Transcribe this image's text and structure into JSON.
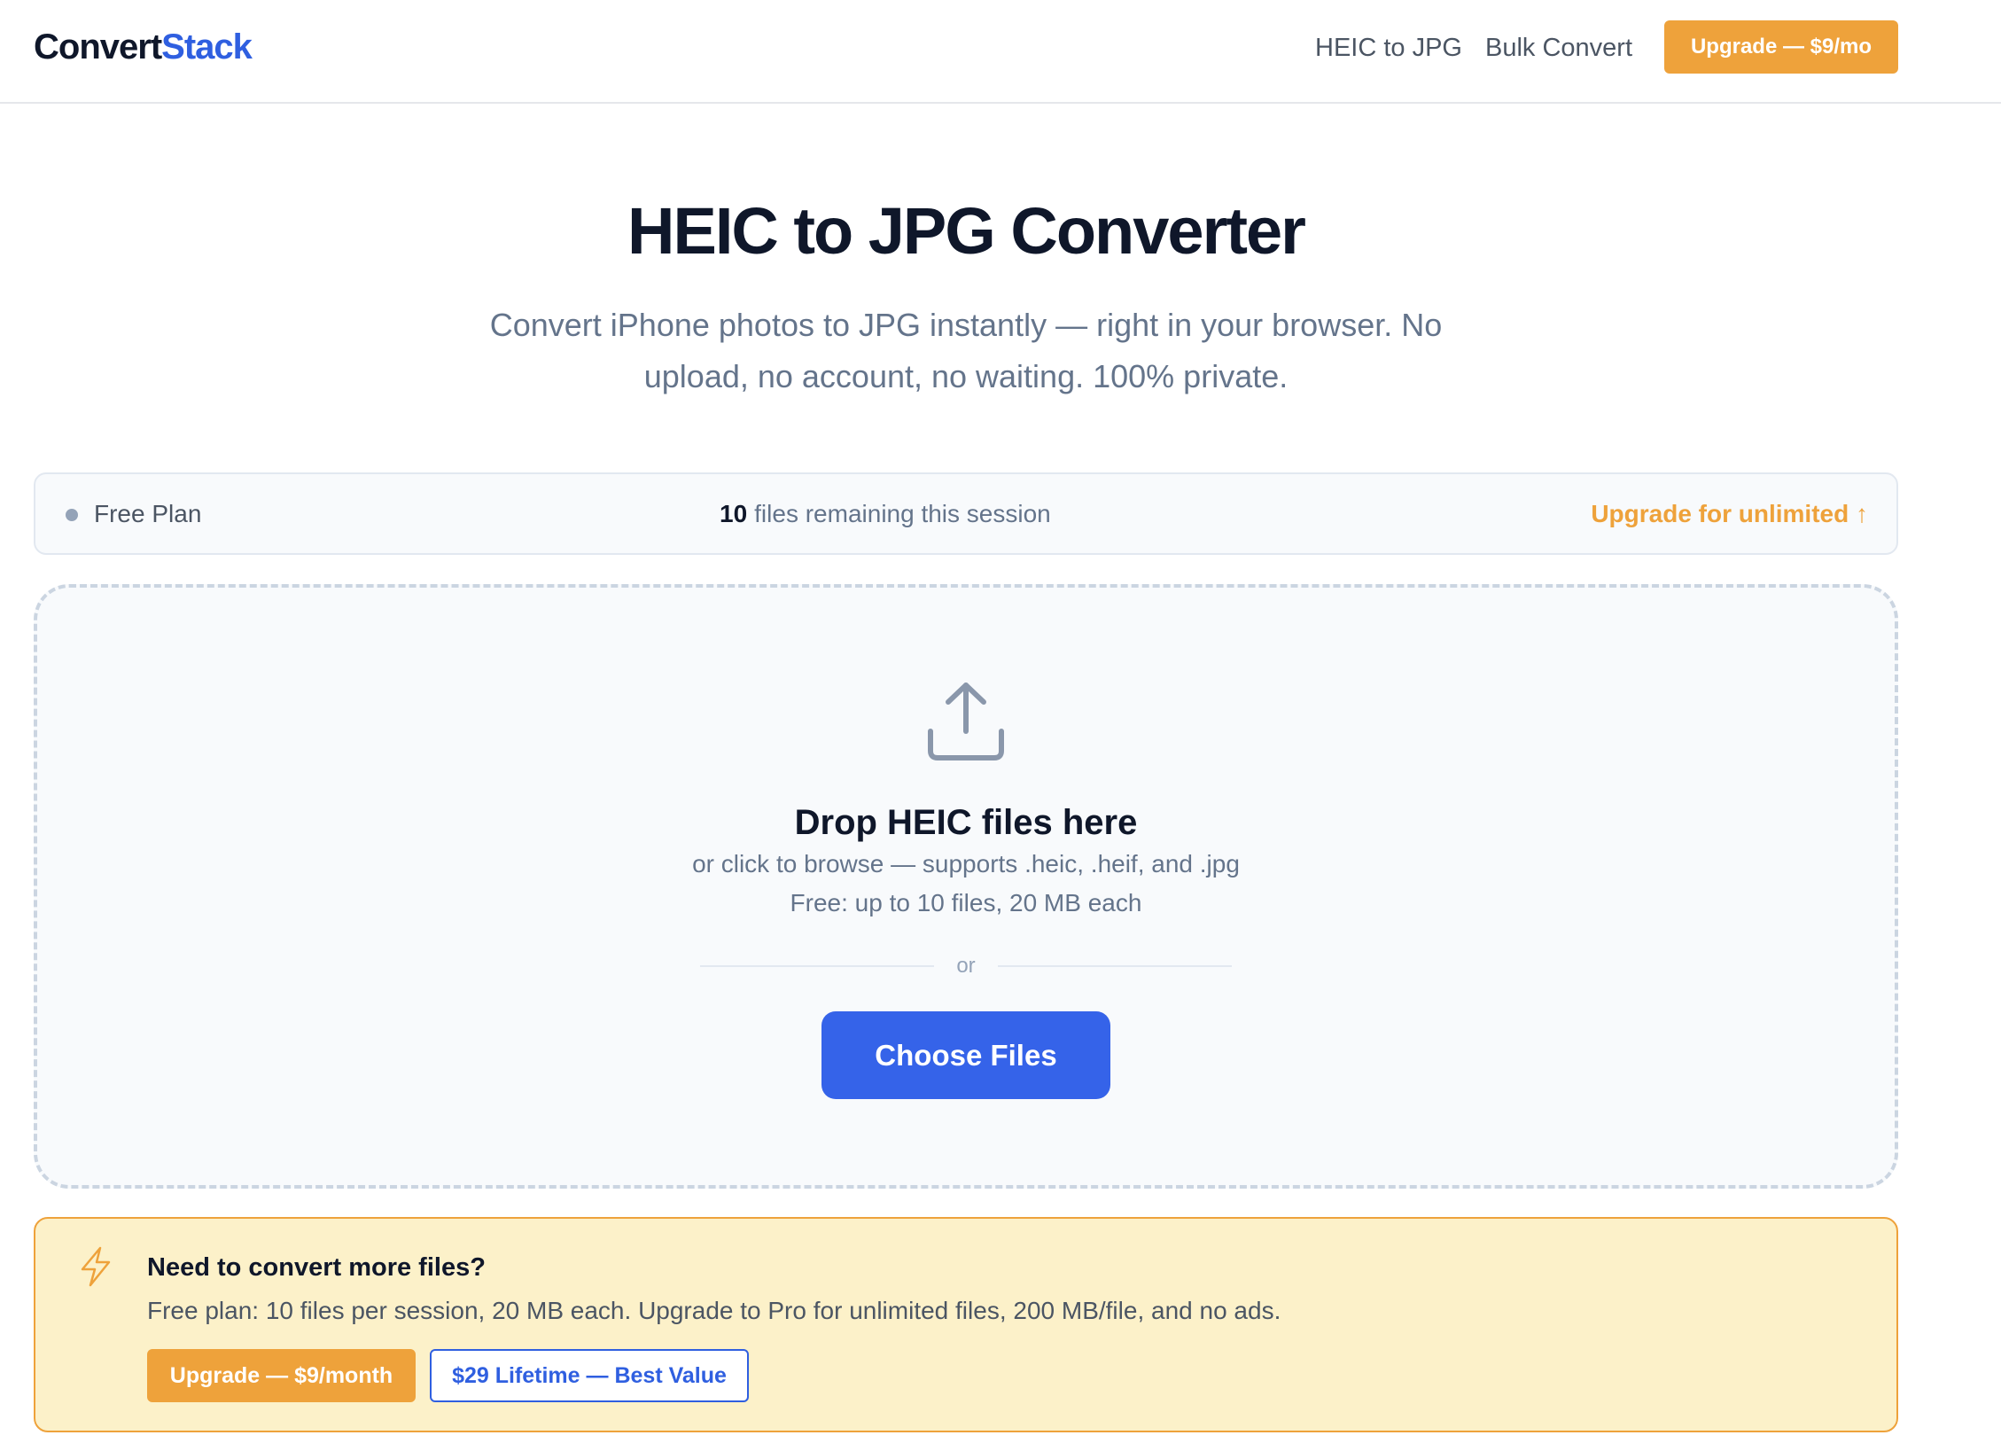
{
  "header": {
    "logo_primary": "Convert",
    "logo_accent": "Stack",
    "nav": [
      {
        "label": "HEIC to JPG"
      },
      {
        "label": "Bulk Convert"
      }
    ],
    "upgrade_label": "Upgrade — $9/mo"
  },
  "hero": {
    "title": "HEIC to JPG Converter",
    "subtitle": "Convert iPhone photos to JPG instantly — right in your browser. No upload, no account, no waiting. 100% private."
  },
  "plan_bar": {
    "plan_name": "Free Plan",
    "remaining_count": "10",
    "remaining_text": "files remaining this session",
    "upgrade_link": "Upgrade for unlimited ↑"
  },
  "dropzone": {
    "icon": "upload-icon",
    "title": "Drop HEIC files here",
    "subtitle": "or click to browse — supports .heic, .heif, and .jpg",
    "limit": "Free: up to 10 files, 20 MB each",
    "divider_text": "or",
    "button_label": "Choose Files"
  },
  "upsell": {
    "icon": "lightning-bolt-icon",
    "title": "Need to convert more files?",
    "text": "Free plan: 10 files per session, 20 MB each. Upgrade to Pro for unlimited files, 200 MB/file, and no ads.",
    "primary_button": "Upgrade — $9/month",
    "secondary_button": "$29 Lifetime — Best Value"
  },
  "colors": {
    "brand_blue": "#3563e9",
    "accent_orange": "#eea23b",
    "upsell_background": "#fcf1c9",
    "heading": "#0f172a",
    "muted_text": "#64748b"
  }
}
